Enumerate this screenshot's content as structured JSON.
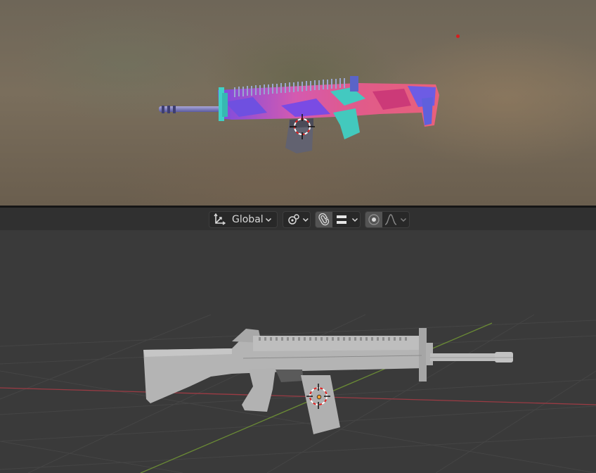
{
  "header": {
    "transform_orientation": {
      "icon": "transform-orientation-icon",
      "label": "Global"
    },
    "pivot_point": {
      "icon": "pivot-point-icon"
    },
    "snapping": {
      "icon": "snap-magnet-icon",
      "increment_icon": "snap-increment-icon"
    },
    "proportional_editing": {
      "icon": "proportional-editing-icon",
      "falloff_icon": "falloff-curve-icon"
    }
  },
  "viewport": {
    "render_preview": {
      "object": "rifle-model-textured",
      "light_color": "#d81e1e"
    },
    "solid_view": {
      "object": "rifle-model-solid",
      "x_axis_color": "#9b3b44",
      "y_axis_color": "#6a8a35"
    }
  },
  "colors": {
    "header_bg": "#303030",
    "button_bg": "#282828",
    "active_bg": "#545454",
    "viewport_bg": "#3a3a3a"
  }
}
